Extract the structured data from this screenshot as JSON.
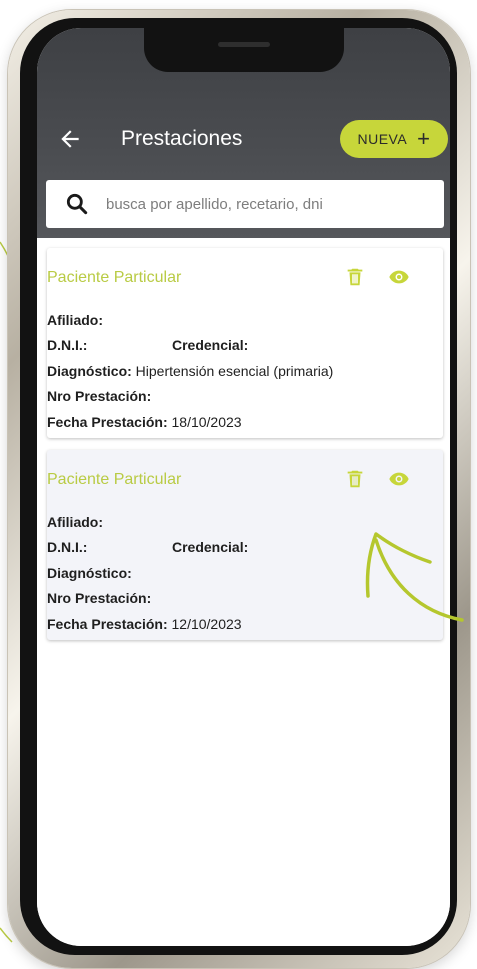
{
  "header": {
    "title": "Prestaciones",
    "new_button_label": "NUEVA",
    "new_button_icon": "+"
  },
  "search": {
    "placeholder": "busca por apellido, recetario, dni",
    "value": ""
  },
  "labels": {
    "afiliado": "Afiliado:",
    "dni": "D.N.I.:",
    "credencial": "Credencial:",
    "diagnostico": "Diagnóstico:",
    "nro_prestacion": "Nro Prestación:",
    "fecha_prestacion": "Fecha Prestación:"
  },
  "prestaciones": [
    {
      "paciente": "Paciente Particular",
      "afiliado": "",
      "dni": "",
      "credencial": "",
      "diagnostico": "Hipertensión esencial (primaria)",
      "nro_prestacion": "",
      "fecha": "18/10/2023"
    },
    {
      "paciente": "Paciente Particular",
      "afiliado": "",
      "dni": "",
      "credencial": "",
      "diagnostico": "",
      "nro_prestacion": "",
      "fecha": "12/10/2023"
    }
  ],
  "colors": {
    "accent": "#c7d63a",
    "patient_name": "#b9cb44",
    "header_bg": "#46484c"
  },
  "icons": {
    "back": "arrow-left-icon",
    "search": "search-icon",
    "delete": "trash-icon",
    "view": "eye-icon",
    "add": "plus-icon"
  }
}
